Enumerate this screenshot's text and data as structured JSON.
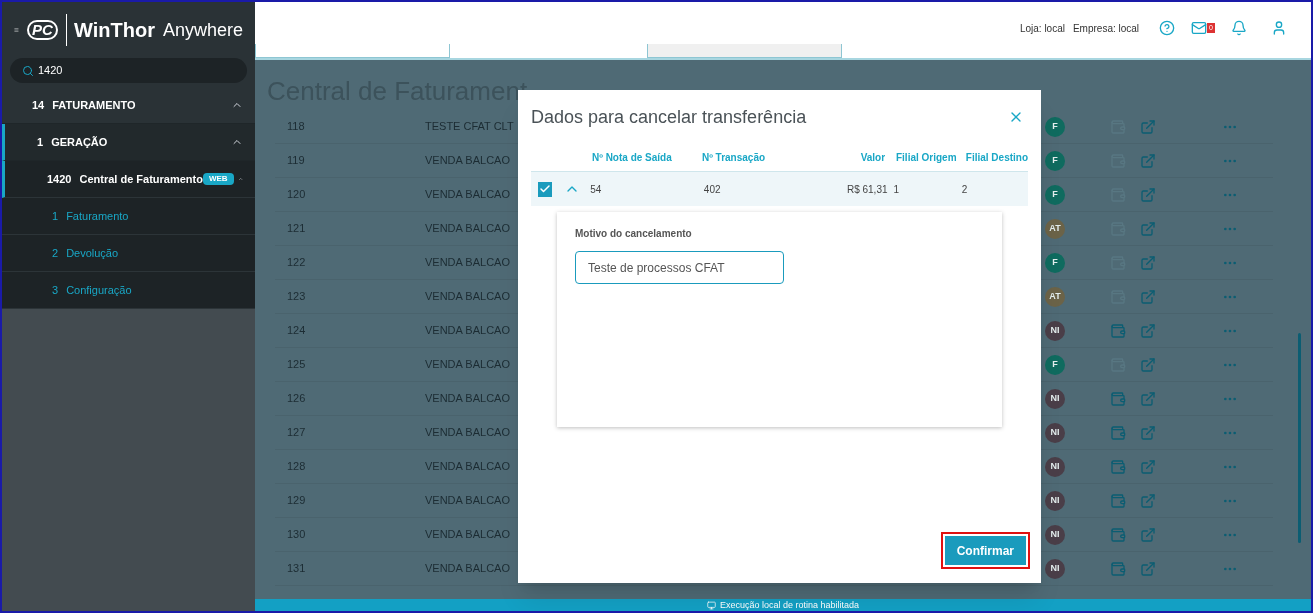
{
  "sidebar": {
    "logo_text": "PC",
    "app_title": "WinThor",
    "app_subtitle": "Anywhere",
    "search": {
      "value": "1420"
    },
    "menu": [
      {
        "code": "14",
        "label": "FATURAMENTO",
        "expanded": true,
        "children": [
          {
            "code": "1",
            "label": "GERAÇÃO",
            "expanded": true,
            "children": [
              {
                "code": "1420",
                "label": "Central de Faturamento",
                "badge": "WEB",
                "expanded": true,
                "children": [
                  {
                    "code": "1",
                    "label": "Faturamento"
                  },
                  {
                    "code": "2",
                    "label": "Devolução"
                  },
                  {
                    "code": "3",
                    "label": "Configuração"
                  }
                ]
              }
            ]
          }
        ]
      }
    ]
  },
  "header": {
    "store": "Loja: local",
    "company": "Empresa: local",
    "mail_count": "0"
  },
  "page": {
    "title": "Central de Faturament",
    "rows": [
      {
        "number": "118",
        "description": "TESTE CFAT CLT",
        "status": "F",
        "color": "#0f6b5f",
        "wallet_enabled": false
      },
      {
        "number": "119",
        "description": "VENDA BALCAO",
        "status": "F",
        "color": "#0f6b5f",
        "wallet_enabled": false
      },
      {
        "number": "120",
        "description": "VENDA BALCAO",
        "status": "F",
        "color": "#0f6b5f",
        "wallet_enabled": false
      },
      {
        "number": "121",
        "description": "VENDA BALCAO",
        "status": "AT",
        "color": "#6b6348",
        "wallet_enabled": false
      },
      {
        "number": "122",
        "description": "VENDA BALCAO",
        "status": "F",
        "color": "#0f6b5f",
        "wallet_enabled": false
      },
      {
        "number": "123",
        "description": "VENDA BALCAO",
        "status": "AT",
        "color": "#6b6348",
        "wallet_enabled": false
      },
      {
        "number": "124",
        "description": "VENDA BALCAO",
        "status": "NI",
        "color": "#4a3e48",
        "wallet_enabled": true
      },
      {
        "number": "125",
        "description": "VENDA BALCAO",
        "status": "F",
        "color": "#0f6b5f",
        "wallet_enabled": false
      },
      {
        "number": "126",
        "description": "VENDA BALCAO",
        "status": "NI",
        "color": "#4a3e48",
        "wallet_enabled": true
      },
      {
        "number": "127",
        "description": "VENDA BALCAO",
        "status": "NI",
        "color": "#4a3e48",
        "wallet_enabled": true
      },
      {
        "number": "128",
        "description": "VENDA BALCAO",
        "status": "NI",
        "color": "#4a3e48",
        "wallet_enabled": true
      },
      {
        "number": "129",
        "description": "VENDA BALCAO",
        "status": "NI",
        "color": "#4a3e48",
        "wallet_enabled": true
      },
      {
        "number": "130",
        "description": "VENDA BALCAO",
        "status": "NI",
        "color": "#4a3e48",
        "wallet_enabled": true
      },
      {
        "number": "131",
        "description": "VENDA BALCAO",
        "status": "NI",
        "color": "#4a3e48",
        "wallet_enabled": true
      }
    ]
  },
  "dialog": {
    "title": "Dados para cancelar transferência",
    "columns": [
      "Nº Nota de Saída",
      "Nº Transação",
      "Valor",
      "Filial Origem",
      "Filial Destino"
    ],
    "rows": [
      {
        "checked": true,
        "expanded": true,
        "cells": [
          "54",
          "402",
          "R$ 61,31",
          "1",
          "2"
        ],
        "detail": {
          "label": "Motivo do cancelamento",
          "value": "Teste de processos CFAT"
        }
      }
    ],
    "confirm_button": "Confirmar"
  },
  "status_bar": "Execução local de rotina habilitada"
}
